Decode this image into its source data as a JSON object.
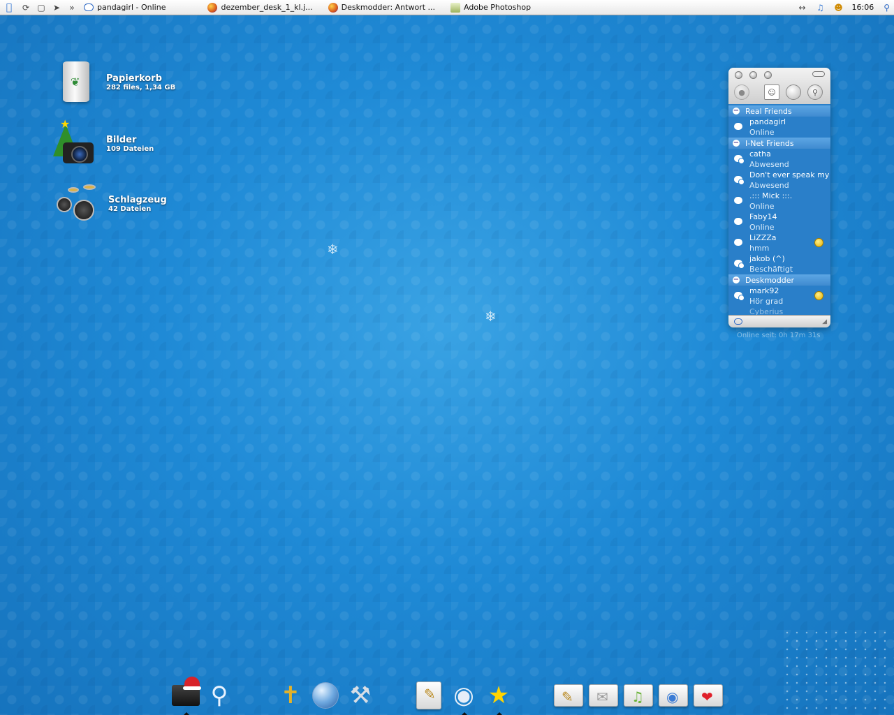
{
  "menubar": {
    "tasks": [
      {
        "label": "pandagirl - Online",
        "icon": "chat-bubble-icon"
      },
      {
        "label": "dezember_desk_1_kl.j...",
        "icon": "firefox-icon"
      },
      {
        "label": "Deskmodder: Antwort ...",
        "icon": "firefox-icon"
      },
      {
        "label": "Adobe Photoshop",
        "icon": "photoshop-icon"
      }
    ],
    "overflow": "»",
    "clock": "16:06"
  },
  "desktop_icons": [
    {
      "name": "Papierkorb",
      "sub": "282 files, 1,34 GB",
      "icon": "trash-icon"
    },
    {
      "name": "Bilder",
      "sub": "109 Dateien",
      "icon": "camera-tree-icon"
    },
    {
      "name": "Schlagzeug",
      "sub": "42 Dateien",
      "icon": "drumkit-icon"
    }
  ],
  "im": {
    "groups": [
      {
        "name": "Real Friends",
        "buddies": [
          {
            "name": "pandagirl",
            "status": "Online",
            "away": false,
            "smiley": false
          }
        ]
      },
      {
        "name": "I-Net Friends",
        "buddies": [
          {
            "name": "catha",
            "status": "Abwesend",
            "away": true,
            "smiley": false
          },
          {
            "name": "Don't ever speak my",
            "status": "Abwesend",
            "away": true,
            "smiley": false
          },
          {
            "name": ".::: Mick :::.",
            "status": "Online",
            "away": false,
            "smiley": false
          },
          {
            "name": "Faby14",
            "status": "Online",
            "away": false,
            "smiley": false
          },
          {
            "name": "LiZZZa",
            "status": "hmm",
            "away": false,
            "smiley": true
          },
          {
            "name": "jakob (^)",
            "status": "Beschäftigt",
            "away": true,
            "smiley": false
          }
        ]
      },
      {
        "name": "Deskmodder",
        "buddies": [
          {
            "name": "mark92",
            "status": "Hör grad",
            "away": true,
            "smiley": true
          }
        ]
      }
    ],
    "cut_off_text": "Cyberius",
    "online_timer": "Online seit: 0h 17m 31s"
  },
  "dock": {
    "items": [
      {
        "name": "finder-santa-icon",
        "running": true
      },
      {
        "name": "spotlight-magnifier-icon",
        "running": false
      },
      {
        "name": "broom-icon",
        "running": false
      },
      {
        "name": "network-globe-icon",
        "running": false
      },
      {
        "name": "tools-icon",
        "running": false
      },
      {
        "name": "notebook-icon",
        "running": false
      },
      {
        "name": "music-cd-icon",
        "running": true
      },
      {
        "name": "favorites-star-icon",
        "running": true
      },
      {
        "name": "documents-folder-icon",
        "running": false
      },
      {
        "name": "mail-folder-icon",
        "running": false
      },
      {
        "name": "music-folder-icon",
        "running": false
      },
      {
        "name": "internet-folder-icon",
        "running": false
      },
      {
        "name": "favorites-folder-icon",
        "running": false
      }
    ]
  }
}
